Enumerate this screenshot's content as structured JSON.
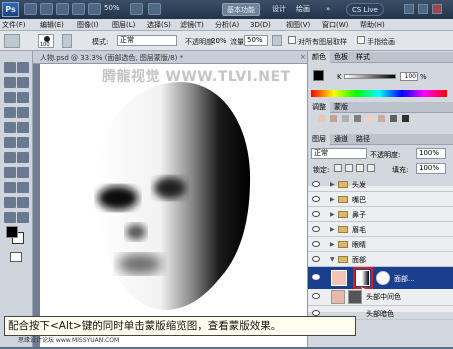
{
  "app": {
    "logo": "Ps",
    "zoom": "50%",
    "workspace_active": "基本功能",
    "workspace_design": "设计",
    "workspace_paint": "绘画",
    "workspace_more": "»",
    "cs_live": "CS Live"
  },
  "menu": [
    "文件(F)",
    "编辑(E)",
    "图像(I)",
    "图层(L)",
    "选择(S)",
    "滤镜(T)",
    "分析(A)",
    "3D(D)",
    "视图(V)",
    "窗口(W)",
    "帮助(H)"
  ],
  "options": {
    "brush_size": "100",
    "mode_label": "模式:",
    "mode_value": "正常",
    "opacity_label": "不透明度:",
    "opacity_value": "20%",
    "flow_label": "流量:",
    "flow_value": "50%",
    "sample_all": "对所有图层取样",
    "hand_paint": "手指绘画"
  },
  "document": {
    "tab_title": "人物.psd @ 33.3% (面部选色, 图层蒙版/8) *",
    "close": "×",
    "watermark": "腾龍视觉 WWW.TLVI.NET"
  },
  "color_panel": {
    "tabs": [
      "颜色",
      "色板",
      "样式"
    ],
    "k_label": "K",
    "k_value": "100",
    "k_unit": "%"
  },
  "adjust_panel": {
    "tabs": [
      "调整",
      "蒙版"
    ]
  },
  "layers_panel": {
    "tabs": [
      "图层",
      "通道",
      "路径"
    ],
    "blend_mode": "正常",
    "opacity_label": "不透明度:",
    "opacity_value": "100%",
    "lock_label": "锁定:",
    "fill_label": "填充:",
    "fill_value": "100%",
    "layers": [
      {
        "name": "头发",
        "type": "group"
      },
      {
        "name": "嘴巴",
        "type": "group"
      },
      {
        "name": "鼻子",
        "type": "group"
      },
      {
        "name": "眉毛",
        "type": "group"
      },
      {
        "name": "眼睛",
        "type": "group"
      },
      {
        "name": "面部",
        "type": "group-open"
      },
      {
        "name": "面部...",
        "type": "layer-selected"
      },
      {
        "name": "头部中间色",
        "type": "layer"
      },
      {
        "name": "头部暗色",
        "type": "layer"
      }
    ]
  },
  "caption": {
    "text": "配合按下<Alt>键的同时单击蒙版缩览图，查看蒙版效果。",
    "credit": "思缘设计论坛 www.MISSYUAN.COM"
  },
  "colors": {
    "accent_blue": "#1b3f8f",
    "highlight_red": "#d62020",
    "panel_bg": "#d3d8df"
  }
}
